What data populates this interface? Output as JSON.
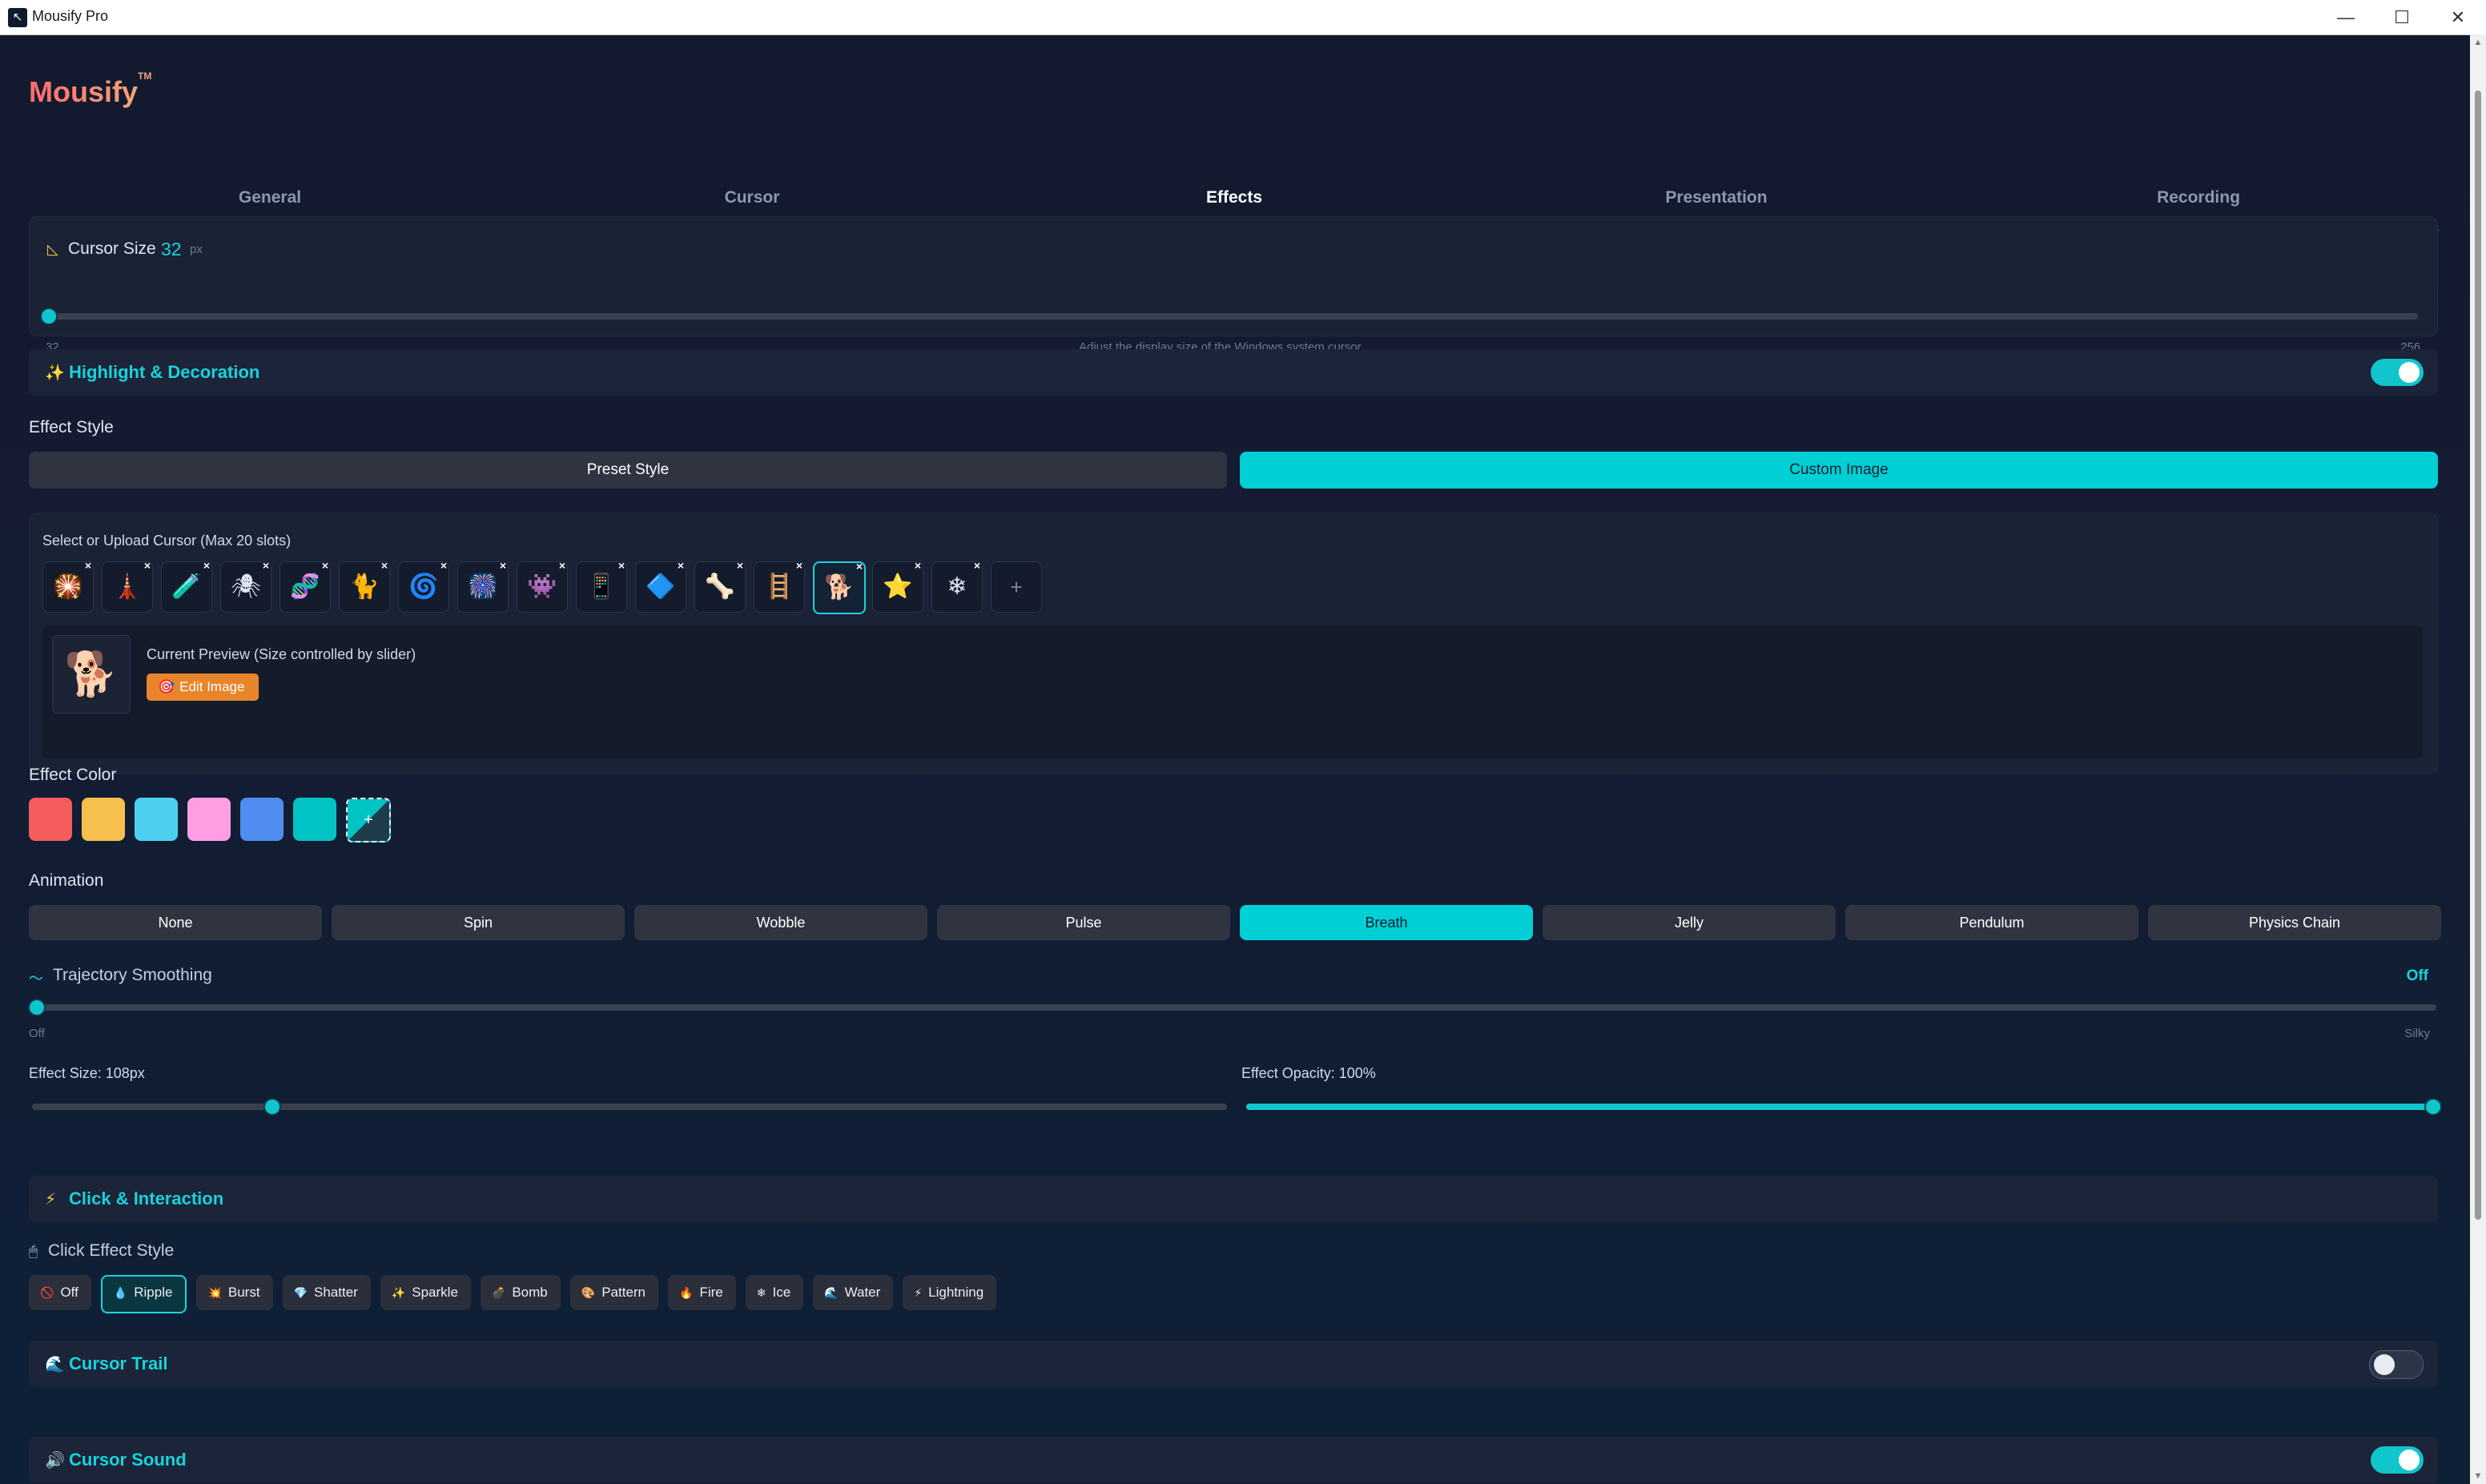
{
  "window": {
    "title": "Mousify Pro"
  },
  "brand": {
    "name": "Mousify",
    "tm": "TM"
  },
  "tabs": [
    {
      "label": "General"
    },
    {
      "label": "Cursor"
    },
    {
      "label": "Effects",
      "active": true
    },
    {
      "label": "Presentation"
    },
    {
      "label": "Recording"
    }
  ],
  "cursor_size": {
    "label": "Cursor Size",
    "value": "32",
    "unit": "px",
    "min": "32",
    "max": "256",
    "hint": "Adjust the display size of the Windows system cursor",
    "fraction": 0.0
  },
  "highlight": {
    "label": "Highlight & Decoration",
    "enabled": true
  },
  "effect_style": {
    "label": "Effect Style",
    "options": [
      "Preset Style",
      "Custom Image"
    ],
    "selected": "Custom Image"
  },
  "upload": {
    "label": "Select or Upload Cursor (Max 20 slots)",
    "slots": [
      "🎇",
      "🗼",
      "🧪",
      "🕷",
      "🧬",
      "🐈",
      "🌀",
      "🎆",
      "👾",
      "📱",
      "🔷",
      "🦴",
      "🪜",
      "🐕",
      "⭐",
      "❄"
    ],
    "selected_index": 13,
    "add_label": "+"
  },
  "preview": {
    "label": "Current Preview (Size controlled by slider)",
    "image": "🐕",
    "edit_label": "Edit Image"
  },
  "effect_color": {
    "label": "Effect Color",
    "swatches": [
      "#f55d5d",
      "#f7c04f",
      "#4dd0f0",
      "#ff9ee3",
      "#4f8df0",
      "#00c4c4"
    ],
    "custom_label": "+"
  },
  "animation": {
    "label": "Animation",
    "options": [
      "None",
      "Spin",
      "Wobble",
      "Pulse",
      "Breath",
      "Jelly",
      "Pendulum",
      "Physics Chain"
    ],
    "selected": "Breath"
  },
  "trajectory": {
    "label": "Trajectory Smoothing",
    "value_label": "Off",
    "min_label": "Off",
    "max_label": "Silky",
    "fraction": 0.0
  },
  "effect_size": {
    "label": "Effect Size: 108px",
    "fraction": 0.2
  },
  "effect_opacity": {
    "label": "Effect Opacity: 100%",
    "fraction": 1.0
  },
  "click_interaction": {
    "label": "Click & Interaction"
  },
  "click_effect": {
    "label": "Click Effect Style",
    "options": [
      {
        "label": "Off",
        "icon": "🚫"
      },
      {
        "label": "Ripple",
        "icon": "💧"
      },
      {
        "label": "Burst",
        "icon": "💥"
      },
      {
        "label": "Shatter",
        "icon": "💎"
      },
      {
        "label": "Sparkle",
        "icon": "✨"
      },
      {
        "label": "Bomb",
        "icon": "💣"
      },
      {
        "label": "Pattern",
        "icon": "🎨"
      },
      {
        "label": "Fire",
        "icon": "🔥"
      },
      {
        "label": "Ice",
        "icon": "❄"
      },
      {
        "label": "Water",
        "icon": "🌊"
      },
      {
        "label": "Lightning",
        "icon": "⚡"
      }
    ],
    "selected": "Ripple"
  },
  "cursor_trail": {
    "label": "Cursor Trail",
    "enabled": false
  },
  "cursor_sound": {
    "label": "Cursor Sound",
    "enabled": true
  }
}
